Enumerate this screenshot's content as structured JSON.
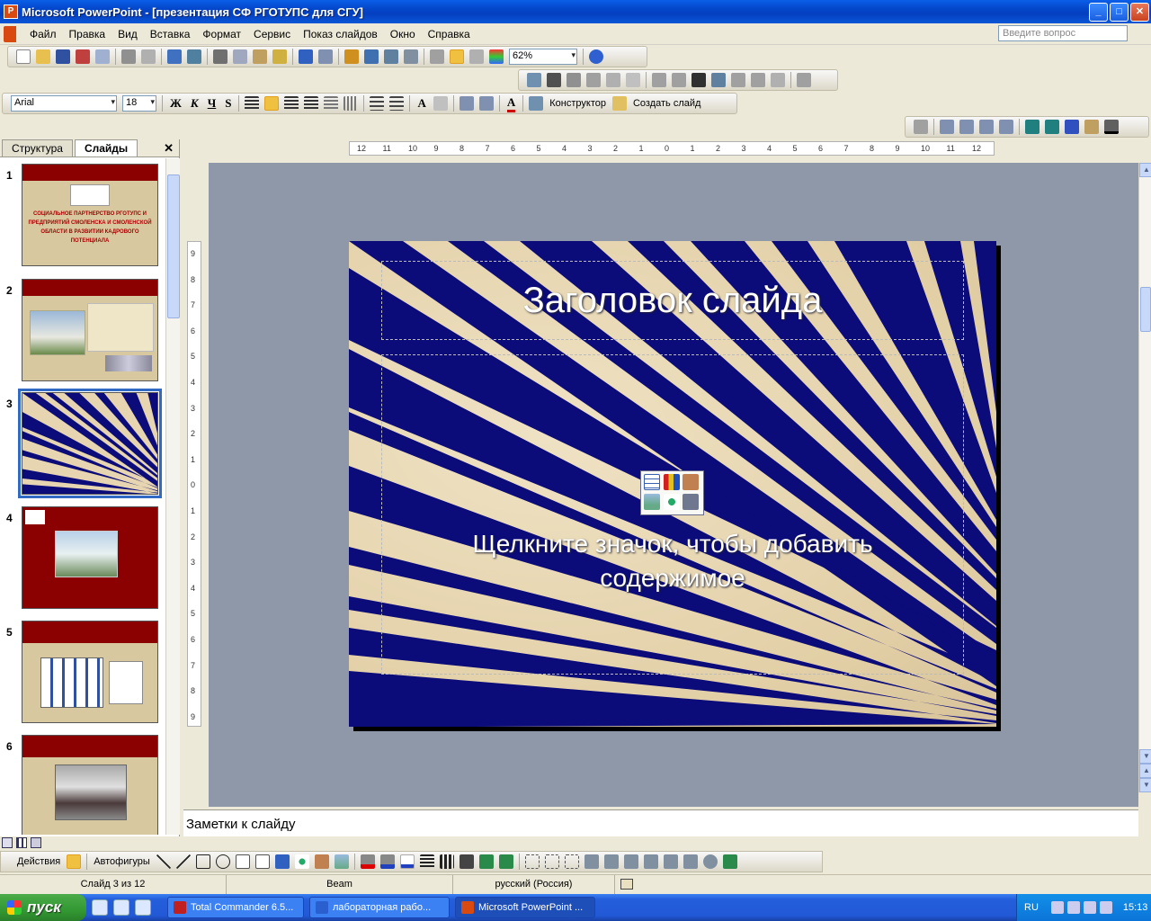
{
  "window": {
    "title": "Microsoft PowerPoint - [презентация СФ РГОТУПС для СГУ]",
    "icon": "powerpoint-icon",
    "minimize": "_",
    "maximize": "□",
    "close": "✕"
  },
  "menu": {
    "items": [
      "Файл",
      "Правка",
      "Вид",
      "Вставка",
      "Формат",
      "Сервис",
      "Показ слайдов",
      "Окно",
      "Справка"
    ],
    "ask_placeholder": "Введите вопрос"
  },
  "toolbar_standard": {
    "zoom": "62%"
  },
  "toolbar_format": {
    "font": "Arial",
    "size": "18",
    "bold": "Ж",
    "italic": "К",
    "underline": "Ч",
    "shadow": "S",
    "grow": "A",
    "color": "A",
    "designer": "Конструктор",
    "new_slide": "Создать слайд"
  },
  "leftpane": {
    "tab_outline": "Структура",
    "tab_slides": "Слайды",
    "close": "✕",
    "thumbs": [
      {
        "num": "1",
        "text": "СОЦИАЛЬНОЕ ПАРТНЕРСТВО РГОТУПС И ПРЕДПРИЯТИЙ СМОЛЕНСКА И СМОЛЕНСКОЙ ОБЛАСТИ В РАЗВИТИИ КАДРОВОГО ПОТЕНЦИАЛА"
      },
      {
        "num": "2",
        "text": ""
      },
      {
        "num": "3",
        "text": ""
      },
      {
        "num": "4",
        "text": ""
      },
      {
        "num": "5",
        "text": ""
      },
      {
        "num": "6",
        "text": ""
      }
    ]
  },
  "ruler_h": [
    "12",
    "11",
    "10",
    "9",
    "8",
    "7",
    "6",
    "5",
    "4",
    "3",
    "2",
    "1",
    "0",
    "1",
    "2",
    "3",
    "4",
    "5",
    "6",
    "7",
    "8",
    "9",
    "10",
    "11",
    "12"
  ],
  "ruler_v": [
    "9",
    "8",
    "7",
    "6",
    "5",
    "4",
    "3",
    "2",
    "1",
    "0",
    "1",
    "2",
    "3",
    "4",
    "5",
    "6",
    "7",
    "8",
    "9"
  ],
  "slide": {
    "title": "Заголовок слайда",
    "body": "Щелкните значок, чтобы добавить содержимое"
  },
  "notes": {
    "placeholder": "Заметки к слайду"
  },
  "drawing": {
    "actions": "Действия",
    "autoshapes": "Автофигуры"
  },
  "status": {
    "slide": "Слайд 3 из 12",
    "design": "Beam",
    "language": "русский (Россия)"
  },
  "taskbar": {
    "start": "пуск",
    "tasks": [
      {
        "label": "Total Commander 6.5...",
        "color": "#c02020"
      },
      {
        "label": "лабораторная рабо...",
        "color": "#2a5fd0"
      },
      {
        "label": "Microsoft PowerPoint ...",
        "color": "#d84a10"
      }
    ],
    "lang": "RU",
    "clock": "15:13"
  },
  "colors": {
    "stripe": "#0b0b7a",
    "slide_bg": "#e6d5b0",
    "accent": "#316ac5"
  }
}
